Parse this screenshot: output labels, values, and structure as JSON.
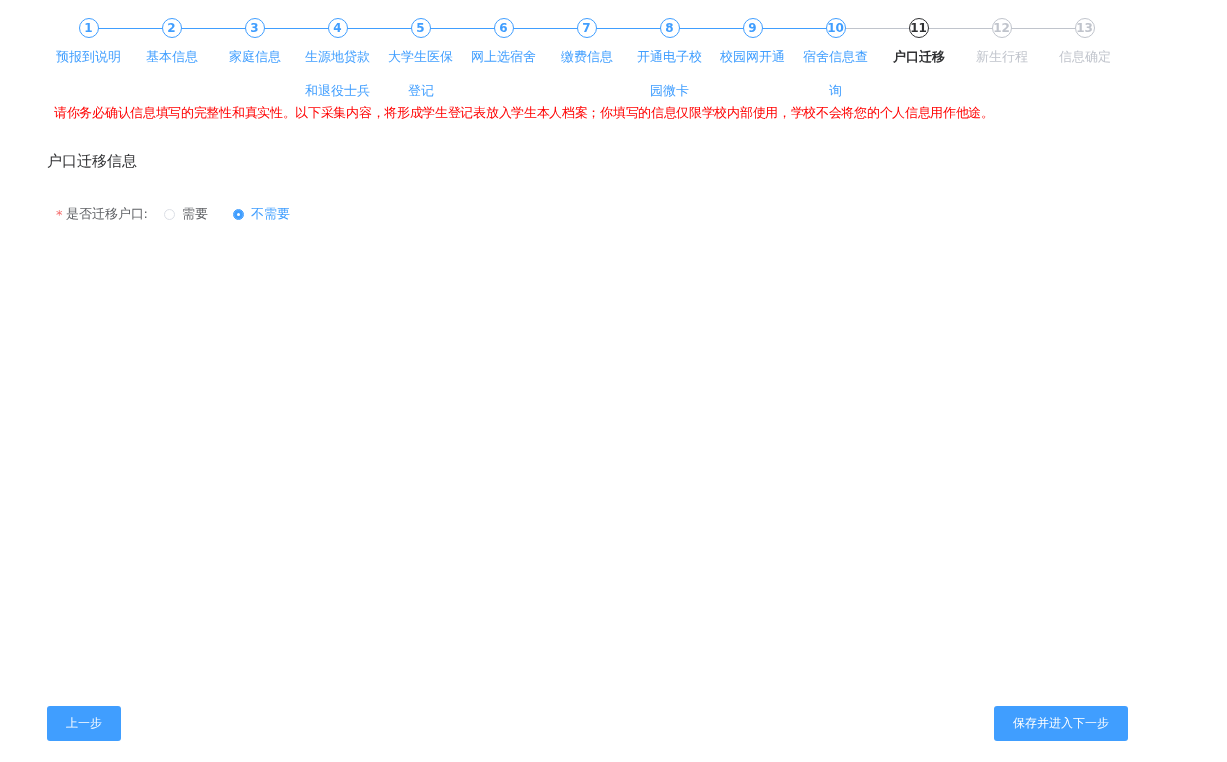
{
  "steps": [
    {
      "number": "1",
      "label": "预报到说明",
      "finished": true,
      "active": false
    },
    {
      "number": "2",
      "label": "基本信息",
      "finished": true,
      "active": false
    },
    {
      "number": "3",
      "label": "家庭信息",
      "finished": true,
      "active": false
    },
    {
      "number": "4",
      "label": "生源地贷款和退役士兵",
      "finished": true,
      "active": false
    },
    {
      "number": "5",
      "label": "大学生医保登记",
      "finished": true,
      "active": false
    },
    {
      "number": "6",
      "label": "网上选宿舍",
      "finished": true,
      "active": false
    },
    {
      "number": "7",
      "label": "缴费信息",
      "finished": true,
      "active": false
    },
    {
      "number": "8",
      "label": "开通电子校园微卡",
      "finished": true,
      "active": false
    },
    {
      "number": "9",
      "label": "校园网开通",
      "finished": true,
      "active": false
    },
    {
      "number": "10",
      "label": "宿舍信息查询",
      "finished": true,
      "active": false
    },
    {
      "number": "11",
      "label": "户口迁移",
      "finished": false,
      "active": true
    },
    {
      "number": "12",
      "label": "新生行程",
      "finished": false,
      "active": false
    },
    {
      "number": "13",
      "label": "信息确定",
      "finished": false,
      "active": false
    }
  ],
  "notice": "请你务必确认信息填写的完整性和真实性。以下采集内容，将形成学生登记表放入学生本人档案；你填写的信息仅限学校内部使用，学校不会将您的个人信息用作他途。",
  "section_title": "户口迁移信息",
  "field": {
    "required_mark": "*",
    "label": "是否迁移户口:",
    "options": [
      {
        "label": "需要",
        "selected": false
      },
      {
        "label": "不需要",
        "selected": true
      }
    ]
  },
  "buttons": {
    "previous": "上一步",
    "next": "保存并进入下一步"
  }
}
